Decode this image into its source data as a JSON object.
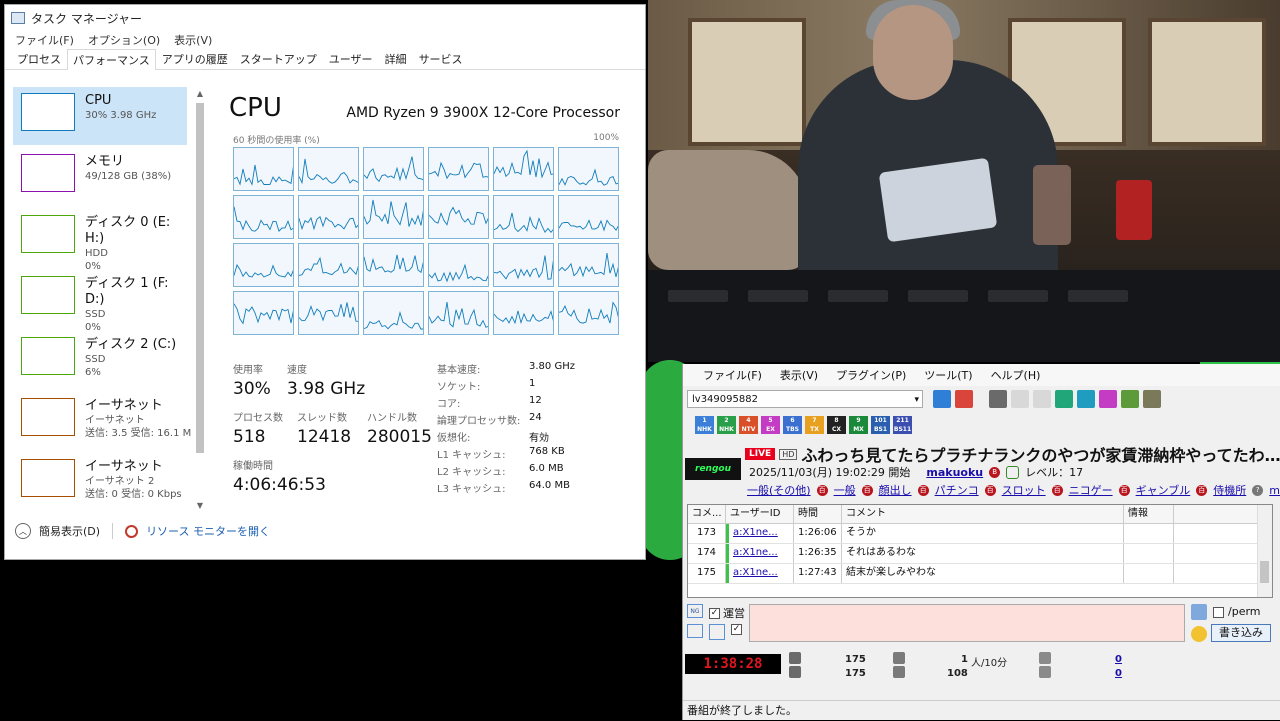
{
  "task_manager": {
    "title": "タスク マネージャー",
    "menu": [
      "ファイル(F)",
      "オプション(O)",
      "表示(V)"
    ],
    "tabs": [
      "プロセス",
      "パフォーマンス",
      "アプリの履歴",
      "スタートアップ",
      "ユーザー",
      "詳細",
      "サービス"
    ],
    "active_tab": "パフォーマンス",
    "resources": [
      {
        "name": "CPU",
        "sub1": "30%  3.98 GHz",
        "sub2": "",
        "sub3": "",
        "color": "#117dbb"
      },
      {
        "name": "メモリ",
        "sub1": "49/128 GB (38%)",
        "sub2": "",
        "sub3": "",
        "color": "#8b12ae"
      },
      {
        "name": "ディスク 0 (E: H:)",
        "sub1": "HDD",
        "sub2": "0%",
        "sub3": "",
        "color": "#4da60c"
      },
      {
        "name": "ディスク 1 (F: D:)",
        "sub1": "SSD",
        "sub2": "0%",
        "sub3": "",
        "color": "#4da60c"
      },
      {
        "name": "ディスク 2 (C:)",
        "sub1": "SSD",
        "sub2": "6%",
        "sub3": "",
        "color": "#4da60c"
      },
      {
        "name": "イーサネット",
        "sub1": "イーサネット",
        "sub2": "送信: 3.5  受信: 16.1 M",
        "sub3": "",
        "color": "#a74f01"
      },
      {
        "name": "イーサネット",
        "sub1": "イーサネット 2",
        "sub2": "送信: 0  受信: 0 Kbps",
        "sub3": "",
        "color": "#a74f01"
      }
    ],
    "cpu": {
      "title": "CPU",
      "model": "AMD Ryzen 9 3900X 12-Core Processor",
      "graph_caption": "60 秒間の使用率 (%)",
      "graph_max": "100%",
      "usage_label": "使用率",
      "usage": "30%",
      "speed_label": "速度",
      "speed": "3.98 GHz",
      "proc_label": "プロセス数",
      "proc": "518",
      "thread_label": "スレッド数",
      "thread": "12418",
      "handle_label": "ハンドル数",
      "handle": "280015",
      "uptime_label": "稼働時間",
      "uptime": "4:06:46:53",
      "specs": [
        {
          "k": "基本速度:",
          "v": "3.80 GHz"
        },
        {
          "k": "ソケット:",
          "v": "1"
        },
        {
          "k": "コア:",
          "v": "12"
        },
        {
          "k": "論理プロセッサ数:",
          "v": "24"
        },
        {
          "k": "仮想化:",
          "v": "有効"
        },
        {
          "k": "L1 キャッシュ:",
          "v": "768 KB"
        },
        {
          "k": "L2 キャッシュ:",
          "v": "6.0 MB"
        },
        {
          "k": "L3 キャッシュ:",
          "v": "64.0 MB"
        }
      ]
    },
    "footer": {
      "simple": "簡易表示(D)",
      "monitor": "リソース モニターを開く"
    }
  },
  "viewer": {
    "menu": [
      "ファイル(F)",
      "表示(V)",
      "プラグイン(P)",
      "ツール(T)",
      "ヘルプ(H)"
    ],
    "live_id": "lv349095882",
    "channels": [
      "1\nNHK",
      "2\nNHK",
      "4\nNTV",
      "5\nEX",
      "6\nTBS",
      "7\nTX",
      "8\nCX",
      "9\nMX",
      "101\nBS1",
      "211\nBS11"
    ],
    "live_badge": "LIVE",
    "hd_badge": "HD",
    "stream_title": "ふわっち見てたらプラチナランクのやつが家賃滞納枠やってたわ…あ",
    "logo_text": "rengou",
    "start": "2025/11/03(月) 19:02:29 開始",
    "user": "makuoku",
    "level": "レベル：17",
    "tags": [
      "一般(その他)",
      "一般",
      "顔出し",
      "パチンコ",
      "スロット",
      "ニコゲー",
      "ギャンブル",
      "侍機所",
      "ma"
    ],
    "columns": [
      "コメ...",
      "ユーザーID",
      "時間",
      "コメント",
      "情報",
      ""
    ],
    "rows": [
      {
        "no": "173",
        "uid": "a:X1ne...",
        "time": "1:26:06",
        "text": "そうか",
        "info": ""
      },
      {
        "no": "174",
        "uid": "a:X1ne...",
        "time": "1:26:35",
        "text": "それはあるわな",
        "info": ""
      },
      {
        "no": "175",
        "uid": "a:X1ne...",
        "time": "1:27:43",
        "text": "結末が楽しみやわな",
        "info": ""
      }
    ],
    "anon_label": "運営",
    "perm_label": "/perm",
    "ng": "NG",
    "write_button": "書き込み",
    "elapsed": "1:38:28",
    "comment_count_a": "175",
    "comment_count_b": "175",
    "viewers_a": "1",
    "viewers_rate": "人/10分",
    "viewers_b": "108",
    "link_a": "0",
    "link_b": "0",
    "status": "番組が終了しました。"
  }
}
